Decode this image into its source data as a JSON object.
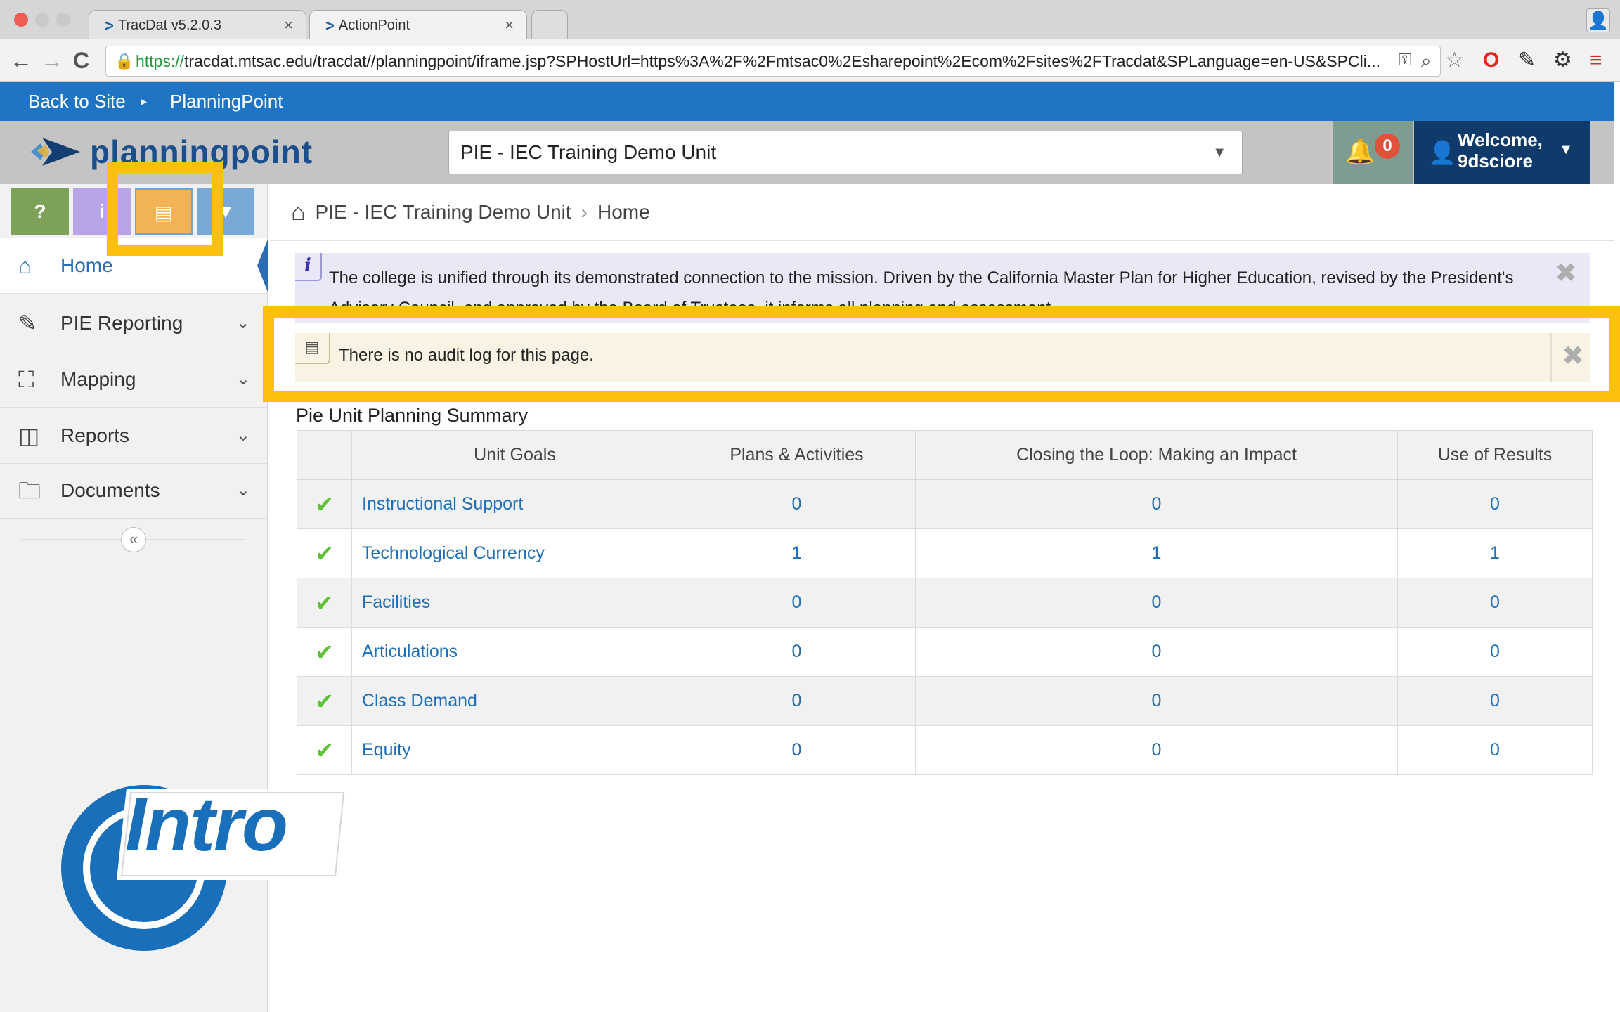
{
  "browser": {
    "tabs": [
      {
        "label": "TracDat v5.2.0.3",
        "close": "×"
      },
      {
        "label": "ActionPoint",
        "close": "×"
      }
    ],
    "url": {
      "scheme": "https://",
      "rest": "tracdat.mtsac.edu/tracdat//planningpoint/iframe.jsp?SPHostUrl=https%3A%2F%2Fmtsac0%2Esharepoint%2Ecom%2Fsites%2FTracdat&SPLanguage=en-US&SPCli..."
    },
    "nav": {
      "back": "←",
      "forward": "→",
      "reload": "C"
    }
  },
  "spbar": {
    "back_label": "Back to Site",
    "separator": "▸",
    "app_label": "PlanningPoint"
  },
  "header": {
    "logo_text": "planningpoint",
    "unit_selector": "PIE - IEC Training Demo Unit",
    "notifications_count": "0",
    "welcome_line1": "Welcome,",
    "welcome_line2": "9dsciore"
  },
  "toolbar": {
    "help_label": "?",
    "info_label": "i",
    "audit_label": "▤",
    "filter_label": "▼"
  },
  "sidebar": {
    "items": [
      {
        "label": "Home",
        "icon": "home-icon"
      },
      {
        "label": "PIE Reporting",
        "icon": "pencil-icon"
      },
      {
        "label": "Mapping",
        "icon": "sitemap-icon"
      },
      {
        "label": "Reports",
        "icon": "columns-icon"
      },
      {
        "label": "Documents",
        "icon": "folder-icon"
      }
    ],
    "collapse_label": "«"
  },
  "intro_logo": "Intro",
  "breadcrumb": {
    "unit": "PIE - IEC Training Demo Unit",
    "sep": "›",
    "page": "Home"
  },
  "info_banner": {
    "icon": "i",
    "text": "The college is unified through its demonstrated connection to the mission. Driven by the California Master Plan for Higher Education, revised by the President's Advisory Council, and approved by the Board of Trustees, it informs all planning and assessment.",
    "close": "✖"
  },
  "audit_banner": {
    "icon": "▤",
    "text": "There is no audit log for this page.",
    "close": "✖"
  },
  "summary": {
    "title": "Pie Unit Planning Summary",
    "columns": [
      "Unit Goals",
      "Plans & Activities",
      "Closing the Loop: Making an Impact",
      "Use of Results"
    ],
    "rows": [
      {
        "check": "✔",
        "goal": "Instructional Support",
        "plans": "0",
        "closing": "0",
        "use": "0"
      },
      {
        "check": "✔",
        "goal": "Technological Currency",
        "plans": "1",
        "closing": "1",
        "use": "1"
      },
      {
        "check": "✔",
        "goal": "Facilities",
        "plans": "0",
        "closing": "0",
        "use": "0"
      },
      {
        "check": "✔",
        "goal": "Articulations",
        "plans": "0",
        "closing": "0",
        "use": "0"
      },
      {
        "check": "✔",
        "goal": "Class Demand",
        "plans": "0",
        "closing": "0",
        "use": "0"
      },
      {
        "check": "✔",
        "goal": "Equity",
        "plans": "0",
        "closing": "0",
        "use": "0"
      }
    ]
  },
  "colors": {
    "sp_blue": "#1f74c4",
    "user_navy": "#0f3a6a",
    "highlight": "#fbbf0d",
    "check_green": "#5fc234",
    "link_blue": "#1f6fb8"
  }
}
